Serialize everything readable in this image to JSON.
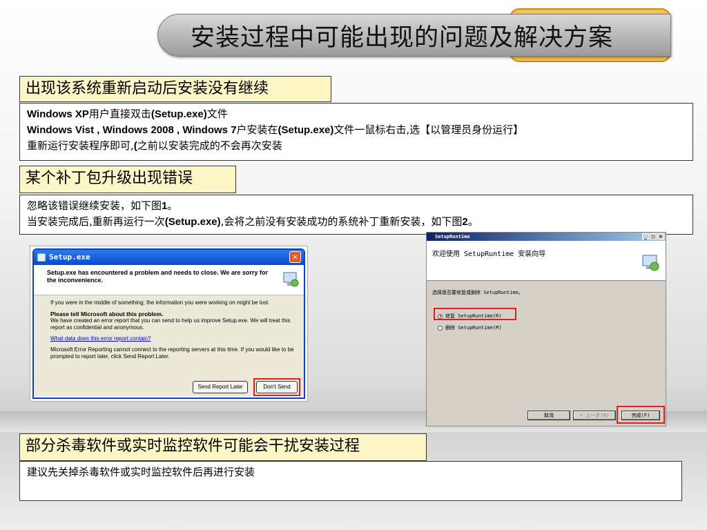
{
  "title": "安装过程中可能出现的问题及解决方案",
  "section1": {
    "header": "出现该系统重新启动后安装没有继续",
    "lines": [
      {
        "a": "Windows XP",
        "b": "用户直接双击",
        "c": "(Setup.exe)",
        "d": "文件"
      },
      {
        "a": "Windows Vist , Windows 2008 , Windows 7",
        "b": "户安装在",
        "c": "(Setup.exe)",
        "d": "文件一鼠标右击,选【以管理员身份运行】"
      },
      {
        "a": "",
        "b": "重新运行安装程序即可,",
        "c": "(",
        "d": "之前以安装完成的不会再次安装"
      }
    ]
  },
  "section2": {
    "header": "某个补丁包升级出现错误",
    "line1_a": "忽略该错误继续安装，如下图",
    "line1_b": "1",
    "line1_c": "。",
    "line2_a": "当安装完成后,重新再运行一次",
    "line2_b": "(Setup.exe)",
    "line2_c": ",会将之前没有安装成功的系统补丁重新安装，如下图",
    "line2_d": "2",
    "line2_e": "。"
  },
  "xp_dialog": {
    "title": "Setup.exe",
    "close": "✕",
    "top_text": "Setup.exe has encountered a problem and needs to close.  We are sorry for the inconvenience.",
    "p1": "If you were in the middle of something, the information you were working on might be lost.",
    "p2_title": "Please tell Microsoft about this problem.",
    "p2": "We have created an error report that you can send to help us improve Setup.exe.  We will treat this report as confidential and anonymous.",
    "link": "What data does this error report contain?",
    "p3": "Microsoft Error Reporting cannot connect to the reporting servers at this time. If you would like to be prompted to report later, click Send Report Later.",
    "btn_later": "Send Report Later",
    "btn_dont": "Don't Send"
  },
  "wizard": {
    "title": "SetupRuntime",
    "heading": "欢迎使用 SetupRuntime 安装向导",
    "prompt": "选择是否要修复或删除 SetupRuntime。",
    "opt_repair": "修复 SetupRuntime(R)",
    "opt_remove": "删除 SetupRuntime(M)",
    "btn_cancel": "取消",
    "btn_back": "< 上一步(B)",
    "btn_finish": "完成(F)"
  },
  "section3": {
    "header": "部分杀毒软件或实时监控软件可能会干扰安装过程",
    "text": "建议先关掉杀毒软件或实时监控软件后再进行安装"
  },
  "colors": {
    "header_bg": "#fdf7c8",
    "title_tab": "#f6c15a",
    "highlight": "#e21c1c",
    "xp_blue": "#0a4ad0"
  }
}
